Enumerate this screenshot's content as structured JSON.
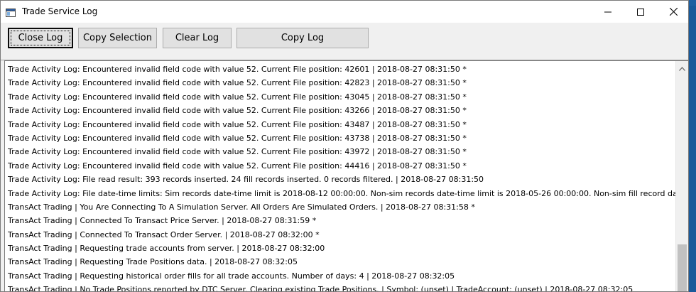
{
  "window": {
    "title": "Trade Service Log"
  },
  "toolbar": {
    "close_log": "Close Log",
    "copy_selection": "Copy Selection",
    "clear_log": "Clear Log",
    "copy_log": "Copy Log"
  },
  "log": {
    "lines": [
      "Trade Activity Log: Encountered invalid field code with value 52. Current File position: 42601 | 2018-08-27  08:31:50 *",
      "Trade Activity Log: Encountered invalid field code with value 52. Current File position: 42823 | 2018-08-27  08:31:50 *",
      "Trade Activity Log: Encountered invalid field code with value 52. Current File position: 43045 | 2018-08-27  08:31:50 *",
      "Trade Activity Log: Encountered invalid field code with value 52. Current File position: 43266 | 2018-08-27  08:31:50 *",
      "Trade Activity Log: Encountered invalid field code with value 52. Current File position: 43487 | 2018-08-27  08:31:50 *",
      "Trade Activity Log: Encountered invalid field code with value 52. Current File position: 43738 | 2018-08-27  08:31:50 *",
      "Trade Activity Log: Encountered invalid field code with value 52. Current File position: 43972 | 2018-08-27  08:31:50 *",
      "Trade Activity Log: Encountered invalid field code with value 52. Current File position: 44416 | 2018-08-27  08:31:50 *",
      "Trade Activity Log: File read result: 393 records inserted.  24 fill records inserted.  0 records filtered. | 2018-08-27  08:31:50",
      "Trade Activity Log: File date-time limits: Sim records date-time limit is 2018-08-12  00:00:00.  Non-sim records date-time limit is 2018-05-26  00:00:00.  Non-sim fill record date-time",
      "TransAct Trading | You Are Connecting To A Simulation Server.  All Orders Are Simulated Orders. | 2018-08-27  08:31:58 *",
      "TransAct Trading | Connected To Transact Price Server. | 2018-08-27  08:31:59 *",
      "TransAct Trading | Connected To Transact Order Server. | 2018-08-27  08:32:00 *",
      "TransAct Trading | Requesting trade accounts from server. | 2018-08-27  08:32:00",
      "TransAct Trading | Requesting Trade Positions data. | 2018-08-27  08:32:05",
      "TransAct Trading | Requesting historical order fills for all trade accounts. Number of days: 4 | 2018-08-27  08:32:05",
      "TransAct Trading | No Trade Positions reported by DTC Server. Clearing existing Trade Positions. | Symbol: (unset) | TradeAccount: (unset) | 2018-08-27  08:32:05"
    ]
  },
  "scroll": {
    "position": 1.0
  }
}
